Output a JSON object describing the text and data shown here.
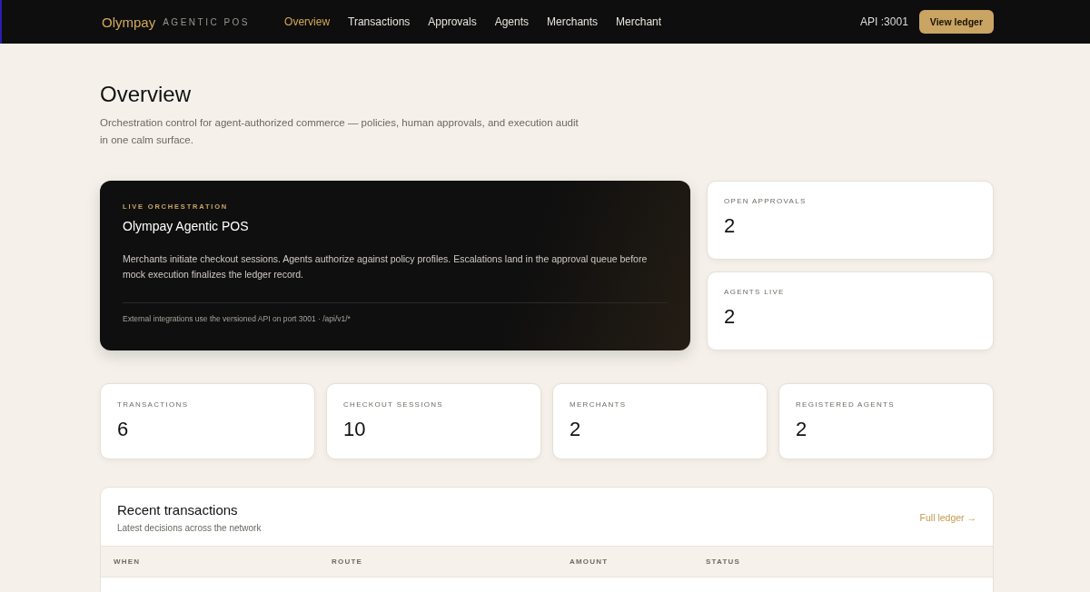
{
  "nav": {
    "brand": "Olympay",
    "brand_sub": "AGENTIC POS",
    "links": [
      {
        "label": "Overview",
        "selected": true
      },
      {
        "label": "Transactions",
        "selected": false
      },
      {
        "label": "Approvals",
        "selected": false
      },
      {
        "label": "Agents",
        "selected": false
      },
      {
        "label": "Merchants",
        "selected": false
      },
      {
        "label": "Merchant",
        "selected": false
      }
    ],
    "api": "API :3001",
    "button": "View ledger"
  },
  "header": {
    "title": "Overview",
    "subtitle": "Orchestration control for agent-authorized commerce — policies, human approvals, and execution audit in one calm surface."
  },
  "hero": {
    "eyebrow": "LIVE ORCHESTRATION",
    "title": "Olympay Agentic POS",
    "body": "Merchants initiate checkout sessions. Agents authorize against policy profiles. Escalations land in the approval queue before mock execution finalizes the ledger record.",
    "footnote": "External integrations use the versioned API on port 3001 · /api/v1/*"
  },
  "side_stats": [
    {
      "label": "OPEN APPROVALS",
      "value": "2"
    },
    {
      "label": "AGENTS LIVE",
      "value": "2"
    }
  ],
  "stats": [
    {
      "label": "TRANSACTIONS",
      "value": "6"
    },
    {
      "label": "CHECKOUT SESSIONS",
      "value": "10"
    },
    {
      "label": "MERCHANTS",
      "value": "2"
    },
    {
      "label": "REGISTERED AGENTS",
      "value": "2"
    }
  ],
  "recent": {
    "title": "Recent transactions",
    "subtitle": "Latest decisions across the network",
    "link": "Full ledger →",
    "columns": [
      "WHEN",
      "ROUTE",
      "AMOUNT",
      "STATUS"
    ]
  }
}
